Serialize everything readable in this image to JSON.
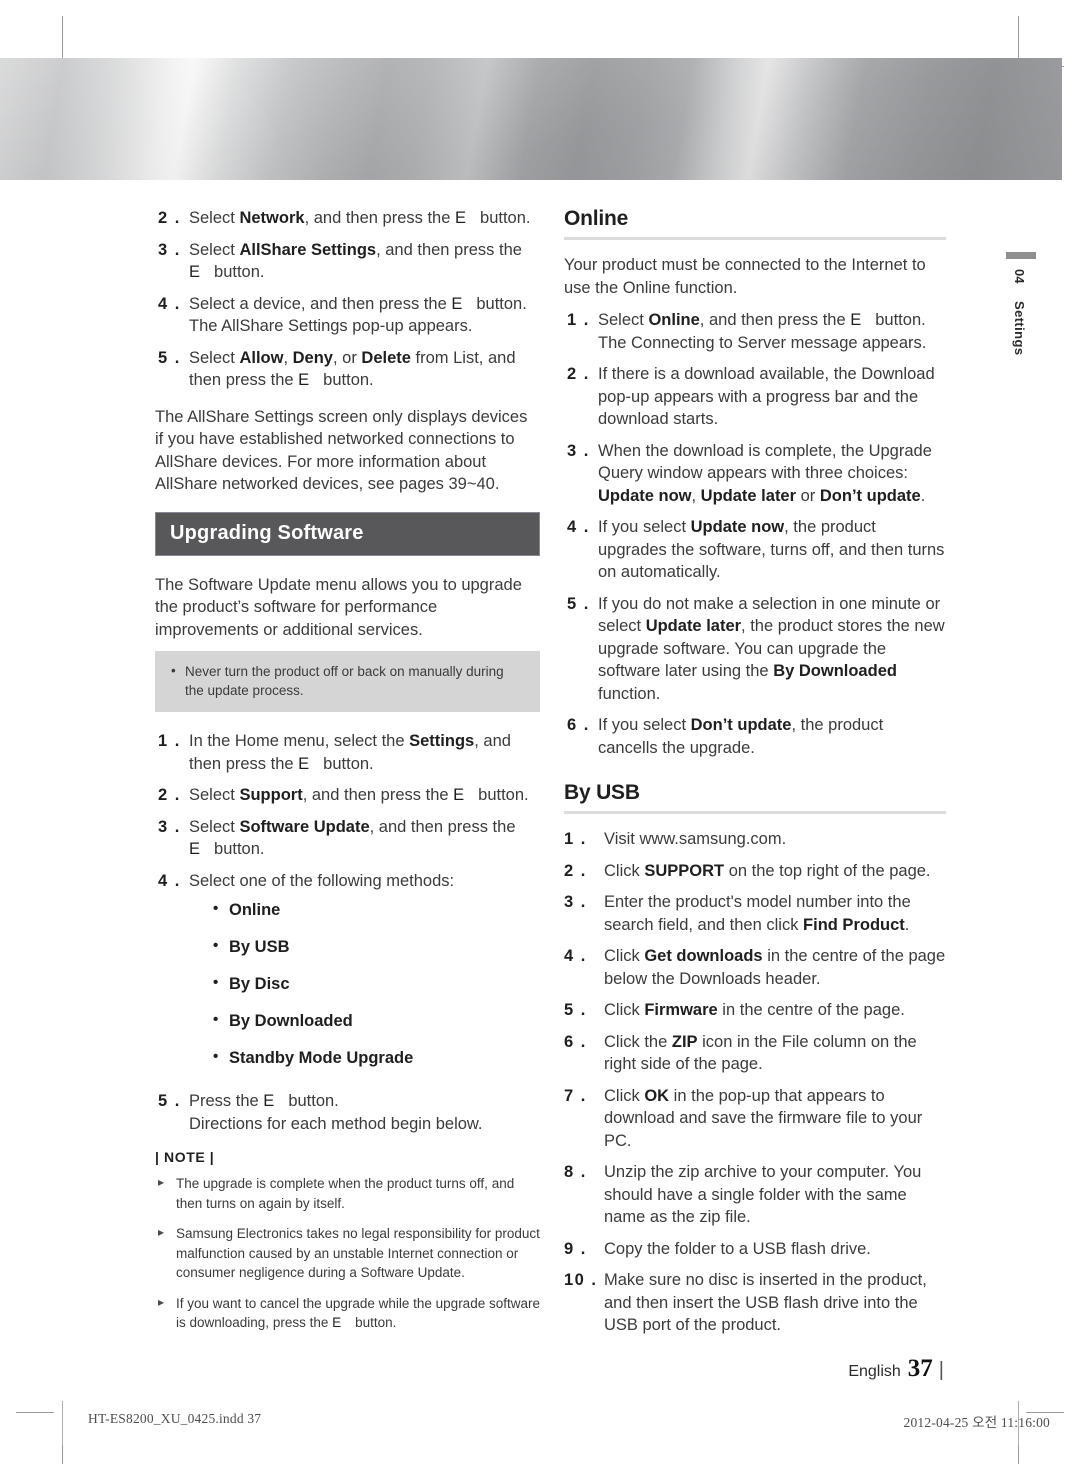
{
  "page": {
    "chapter_number": "04",
    "chapter_label": "Settings",
    "language": "English",
    "page_number": "37",
    "folio_tick": "|"
  },
  "print_info": {
    "filename": "HT-ES8200_XU_0425.indd   37",
    "timestamp": "2012-04-25   오전 11:16:00"
  },
  "left_column": {
    "allshare_steps": [
      {
        "num": "2 .",
        "pre": "Select ",
        "bold1": "Network",
        "mid": ", and then press the ",
        "ekey": "E",
        "post": "button."
      },
      {
        "num": "3 .",
        "pre": "Select ",
        "bold1": "AllShare Settings",
        "mid": ", and then press the ",
        "ekey": "E",
        "post": "button."
      },
      {
        "num": "4 .",
        "pre": "Select a device, and then press the ",
        "bold1": "",
        "mid": "",
        "ekey": "E",
        "post": "button. The AllShare Settings pop-up appears."
      },
      {
        "num": "5 .",
        "pre": "Select ",
        "bold1": "Allow",
        "mid": ", ",
        "bold2": "Deny",
        "mid2": ", or ",
        "bold3": "Delete",
        "mid3": " from List, and then press the ",
        "ekey": "E",
        "post": "button."
      }
    ],
    "allshare_paragraph": "The AllShare Settings screen only displays devices if you have established networked connections to AllShare devices. For more information about AllShare networked devices, see pages 39~40.",
    "band_title": "Upgrading Software",
    "intro_paragraph": "The Software Update menu allows you to upgrade the product’s software for performance improvements or additional services.",
    "caution_items": [
      "Never turn the product off or back on manually during the update process."
    ],
    "upgrade_steps": [
      {
        "num": "1 .",
        "pre": "In the Home menu, select the ",
        "bold1": "Settings",
        "mid": ", and then press the ",
        "ekey": "E",
        "post": "button."
      },
      {
        "num": "2 .",
        "pre": "Select ",
        "bold1": "Support",
        "mid": ", and then press the ",
        "ekey": "E",
        "post": "button."
      },
      {
        "num": "3 .",
        "pre": "Select ",
        "bold1": "Software Update",
        "mid": ", and then press the ",
        "ekey": "E",
        "post": "button."
      }
    ],
    "step4_num": "4 .",
    "step4_text": "Select one of the following methods:",
    "methods": [
      "Online",
      "By USB",
      "By Disc",
      "By Downloaded",
      "Standby Mode Upgrade"
    ],
    "step5_num": "5 .",
    "step5_pre": "Press the ",
    "step5_ekey": "E",
    "step5_post": "button.",
    "step5_line2": "Directions for each method begin below.",
    "note_label": "| NOTE |",
    "note_items": [
      "The upgrade is complete when the product turns off, and then turns on again by itself.",
      "Samsung Electronics takes no legal responsibility for product malfunction caused by an unstable Internet connection or consumer negligence during a Software Update.",
      "If you want to cancel the upgrade while the upgrade software is downloading, press the E button."
    ],
    "note_item3_pre": "If you want to cancel the upgrade while the upgrade software is downloading, press the ",
    "note_item3_ekey": "E",
    "note_item3_post": "button."
  },
  "right_column": {
    "online_heading": "Online",
    "online_paragraph": "Your product must be connected to the Internet to use the Online function.",
    "online_steps": [
      {
        "num": "1 .",
        "pre": "Select ",
        "bold1": "Online",
        "mid": ", and then press the ",
        "ekey": "E",
        "post": "button. The Connecting to Server message appears."
      },
      {
        "num": "2 .",
        "text": "If there is a download available, the Download pop-up appears with a progress bar and the download starts."
      },
      {
        "num": "3 .",
        "pre": "When the download is complete, the Upgrade Query window appears with three choices: ",
        "bold1": "Update now",
        "mid": ", ",
        "bold2": "Update later",
        "mid2": " or ",
        "bold3": "Don’t update",
        "mid3": "."
      },
      {
        "num": "4 .",
        "pre": "If you select ",
        "bold1": "Update now",
        "mid": ", the product upgrades the software, turns off, and then turns on automatically."
      },
      {
        "num": "5 .",
        "pre": "If you do not make a selection in one minute or select ",
        "bold1": "Update later",
        "mid": ", the product stores the new upgrade software. You can upgrade the software later using the ",
        "bold2": "By Downloaded",
        "mid2": " function."
      },
      {
        "num": "6 .",
        "pre": "If you select ",
        "bold1": "Don’t update",
        "mid": ", the product cancells the upgrade."
      }
    ],
    "usb_heading": "By USB",
    "usb_steps": [
      {
        "num": "1 .",
        "text": "Visit www.samsung.com."
      },
      {
        "num": "2 .",
        "pre": "Click ",
        "bold1": "SUPPORT",
        "mid": " on the top right of the page."
      },
      {
        "num": "3 .",
        "pre": "Enter the product's model number into the search field, and then click ",
        "bold1": "Find Product",
        "mid": "."
      },
      {
        "num": "4 .",
        "pre": "Click ",
        "bold1": "Get downloads",
        "mid": " in the centre of the page below the Downloads header."
      },
      {
        "num": "5 .",
        "pre": "Click ",
        "bold1": "Firmware",
        "mid": " in the centre of the page."
      },
      {
        "num": "6 .",
        "pre": "Click the ",
        "bold1": "ZIP",
        "mid": " icon in the File column on the right side of the page."
      },
      {
        "num": "7 .",
        "pre": "Click ",
        "bold1": "OK",
        "mid": " in the pop-up that appears to download and save the firmware file to your PC."
      },
      {
        "num": "8 .",
        "text": "Unzip the zip archive to your computer. You should have a single folder with the same name as the zip file."
      },
      {
        "num": "9 .",
        "text": "Copy the folder to a USB flash drive."
      },
      {
        "num": "10 .",
        "text": "Make sure no disc is inserted in the product, and then insert the USB flash drive into the USB port of the product."
      }
    ]
  },
  "colors": {
    "band_bg": "#58585a",
    "band_border": "#8b8795",
    "caution_bg": "#d5d5d5",
    "rule": "#dcdcdc",
    "body_text": "#3b3b3d",
    "bold_text": "#1f1f21"
  }
}
